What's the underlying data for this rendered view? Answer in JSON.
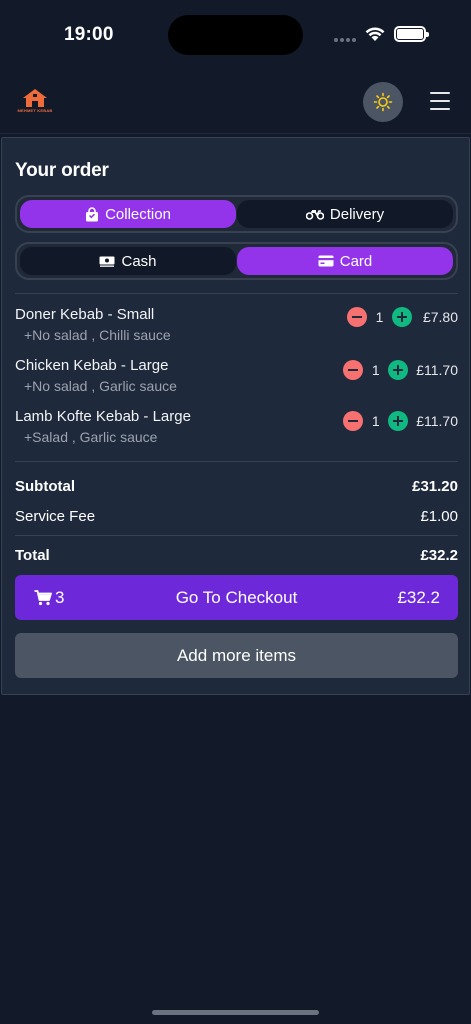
{
  "status_bar": {
    "time": "19:00"
  },
  "brand": {
    "logo_text": "MEHMET KEBAB",
    "accent": "#ef6c3a"
  },
  "order": {
    "title": "Your order",
    "fulfilment": {
      "options": [
        "Collection",
        "Delivery"
      ],
      "selected": "Collection"
    },
    "payment": {
      "options": [
        "Cash",
        "Card"
      ],
      "selected": "Card"
    },
    "items": [
      {
        "name": "Doner Kebab - Small",
        "options": "+No salad , Chilli sauce",
        "quantity": "1",
        "price": "£7.80"
      },
      {
        "name": "Chicken Kebab - Large",
        "options": "+No salad , Garlic sauce",
        "quantity": "1",
        "price": "£11.70"
      },
      {
        "name": "Lamb Kofte Kebab - Large",
        "options": "+Salad , Garlic sauce",
        "quantity": "1",
        "price": "£11.70"
      }
    ],
    "summary": {
      "subtotal_label": "Subtotal",
      "subtotal": "£31.20",
      "service_fee_label": "Service Fee",
      "service_fee": "£1.00",
      "total_label": "Total",
      "total": "£32.2"
    },
    "checkout": {
      "cart_count": "3",
      "label": "Go To Checkout",
      "total": "£32.2"
    },
    "add_more_label": "Add more items"
  },
  "colors": {
    "background": "#121a2a",
    "card": "#1e293b",
    "accent_purple": "#9333ea",
    "checkout_purple": "#6d28d9",
    "minus_red": "#f87171",
    "plus_green": "#10b981"
  },
  "icons": {
    "theme": "sun-icon",
    "menu": "hamburger-menu-icon",
    "collection": "shopping-bag-icon",
    "delivery": "motorcycle-icon",
    "cash": "cash-icon",
    "card": "credit-card-icon",
    "cart": "cart-icon"
  }
}
